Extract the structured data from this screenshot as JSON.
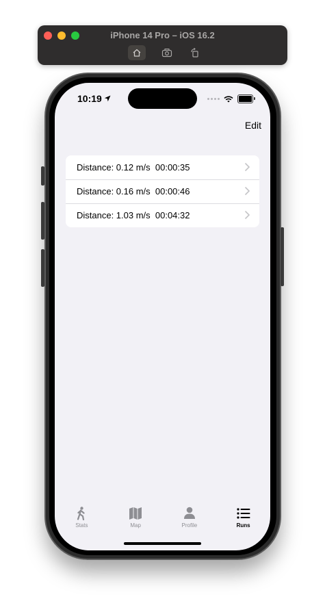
{
  "window": {
    "title": "iPhone 14 Pro – iOS 16.2",
    "toolbar_icons": [
      "home-icon",
      "screenshot-icon",
      "rotate-icon"
    ]
  },
  "status_bar": {
    "time": "10:19",
    "icons": [
      "location-arrow-icon",
      "signal-dots-icon",
      "wifi-icon",
      "battery-icon"
    ]
  },
  "nav": {
    "edit_label": "Edit"
  },
  "runs": [
    {
      "text": "Distance: 0.12 m/s  00:00:35"
    },
    {
      "text": "Distance: 0.16 m/s  00:00:46"
    },
    {
      "text": "Distance: 1.03 m/s  00:04:32"
    }
  ],
  "tabs": [
    {
      "label": "Stats",
      "icon": "walking-figure-icon",
      "active": false
    },
    {
      "label": "Map",
      "icon": "map-icon",
      "active": false
    },
    {
      "label": "Profile",
      "icon": "person-icon",
      "active": false
    },
    {
      "label": "Runs",
      "icon": "list-icon",
      "active": true
    }
  ],
  "colors": {
    "screen_background": "#f2f1f6",
    "tab_inactive": "#8e8e93",
    "tab_active": "#000000",
    "close": "#ff5f57",
    "minimize": "#febc2e",
    "maximize": "#28c840"
  }
}
